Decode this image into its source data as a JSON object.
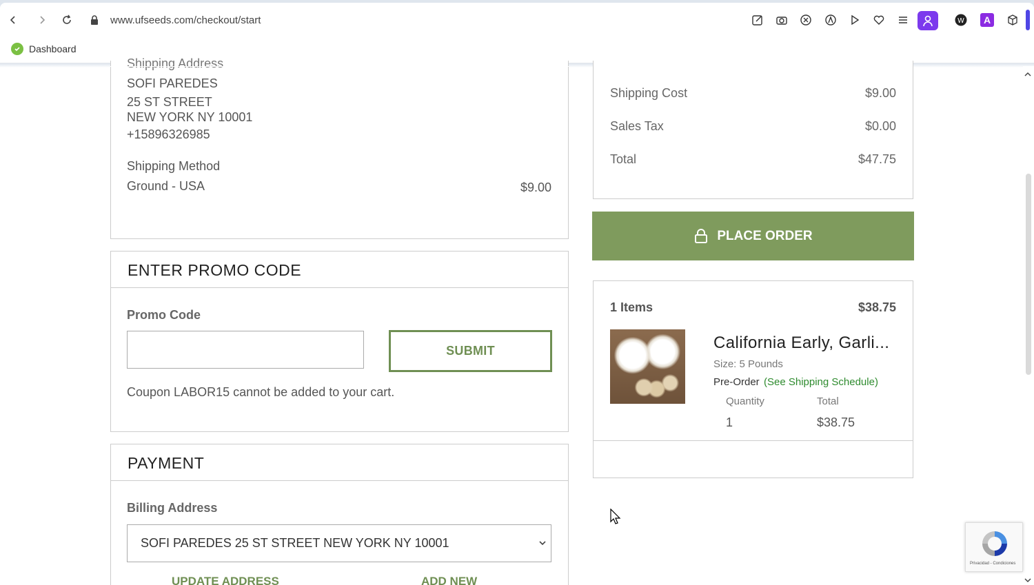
{
  "browser": {
    "url": "www.ufseeds.com/checkout/start",
    "bookmark": "Dashboard",
    "profile_letter": "A"
  },
  "shipping": {
    "heading_partial": "Shipping Address",
    "name": "SOFI PAREDES",
    "street": "25 ST STREET",
    "city": "NEW YORK NY 10001",
    "phone": "+15896326985",
    "method_label": "Shipping Method",
    "method": "Ground - USA",
    "method_price": "$9.00"
  },
  "promo": {
    "title": "ENTER PROMO CODE",
    "label": "Promo Code",
    "value": "",
    "submit": "SUBMIT",
    "message": "Coupon LABOR15 cannot be added to your cart."
  },
  "payment": {
    "title": "PAYMENT",
    "billing_label": "Billing Address",
    "billing_selected": "SOFI PAREDES 25 ST STREET NEW YORK NY 10001",
    "update_link": "UPDATE ADDRESS",
    "add_link": "ADD NEW"
  },
  "summary": {
    "rows": [
      {
        "label": "Shipping Cost",
        "value": "$9.00"
      },
      {
        "label": "Sales Tax",
        "value": "$0.00"
      },
      {
        "label": "Total",
        "value": "$47.75"
      }
    ],
    "place_order": "PLACE ORDER"
  },
  "cart": {
    "items_label": "1 Items",
    "items_total": "$38.75",
    "product_name": "California Early, Garli...",
    "size": "Size: 5 Pounds",
    "preorder": "Pre-Order",
    "schedule_link": "(See Shipping Schedule)",
    "qty_label": "Quantity",
    "total_label": "Total",
    "qty": "1",
    "line_total": "$38.75"
  },
  "recaptcha_text": "Privacidad - Condiciones",
  "colors": {
    "accent_green": "#7f9b5d",
    "link_green": "#2e8b2e"
  }
}
